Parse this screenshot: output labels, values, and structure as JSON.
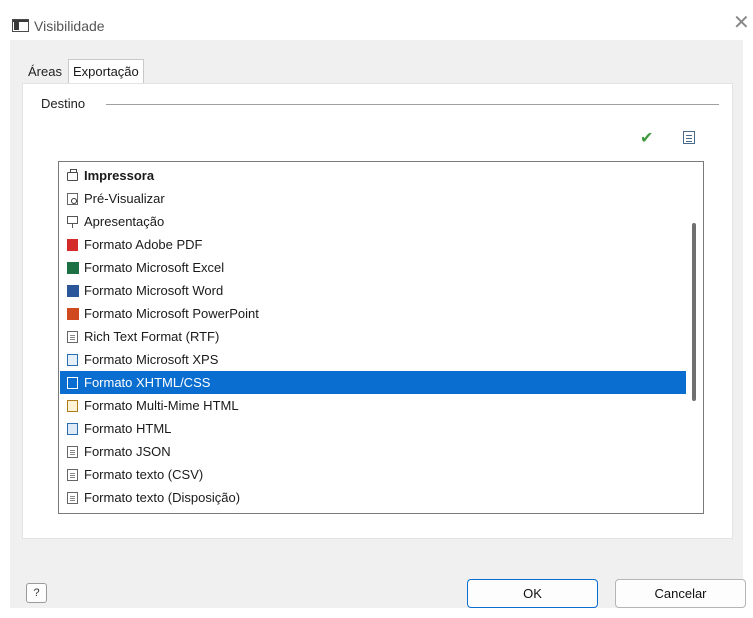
{
  "window": {
    "title": "Visibilidade",
    "close_glyph": "✕"
  },
  "tabs": [
    {
      "label": "Áreas",
      "active": false
    },
    {
      "label": "Exportação",
      "active": true
    }
  ],
  "group": {
    "label": "Destino"
  },
  "toolbar": {
    "check_icon": "checkmark-icon",
    "properties_icon": "properties-icon"
  },
  "list": {
    "selected_index": 9,
    "items": [
      {
        "label": "Impressora",
        "icon": "printer-icon"
      },
      {
        "label": "Pré-Visualizar",
        "icon": "preview-icon"
      },
      {
        "label": "Apresentação",
        "icon": "presentation-icon"
      },
      {
        "label": "Formato Adobe PDF",
        "icon": "pdf-icon"
      },
      {
        "label": "Formato Microsoft Excel",
        "icon": "excel-icon"
      },
      {
        "label": "Formato Microsoft Word",
        "icon": "word-icon"
      },
      {
        "label": "Formato Microsoft PowerPoint",
        "icon": "powerpoint-icon"
      },
      {
        "label": "Rich Text Format (RTF)",
        "icon": "rtf-icon"
      },
      {
        "label": "Formato Microsoft XPS",
        "icon": "xps-icon"
      },
      {
        "label": "Formato XHTML/CSS",
        "icon": "xhtml-icon"
      },
      {
        "label": "Formato Multi-Mime HTML",
        "icon": "mime-html-icon"
      },
      {
        "label": "Formato HTML",
        "icon": "html-icon"
      },
      {
        "label": "Formato JSON",
        "icon": "json-icon"
      },
      {
        "label": "Formato texto (CSV)",
        "icon": "csv-icon"
      },
      {
        "label": "Formato texto (Disposição)",
        "icon": "text-layout-icon"
      }
    ]
  },
  "buttons": {
    "help": "?",
    "ok": "OK",
    "cancel": "Cancelar"
  },
  "colors": {
    "selection": "#0a6ed1",
    "check": "#3c9a3c",
    "ok_border": "#0a6ed1"
  }
}
